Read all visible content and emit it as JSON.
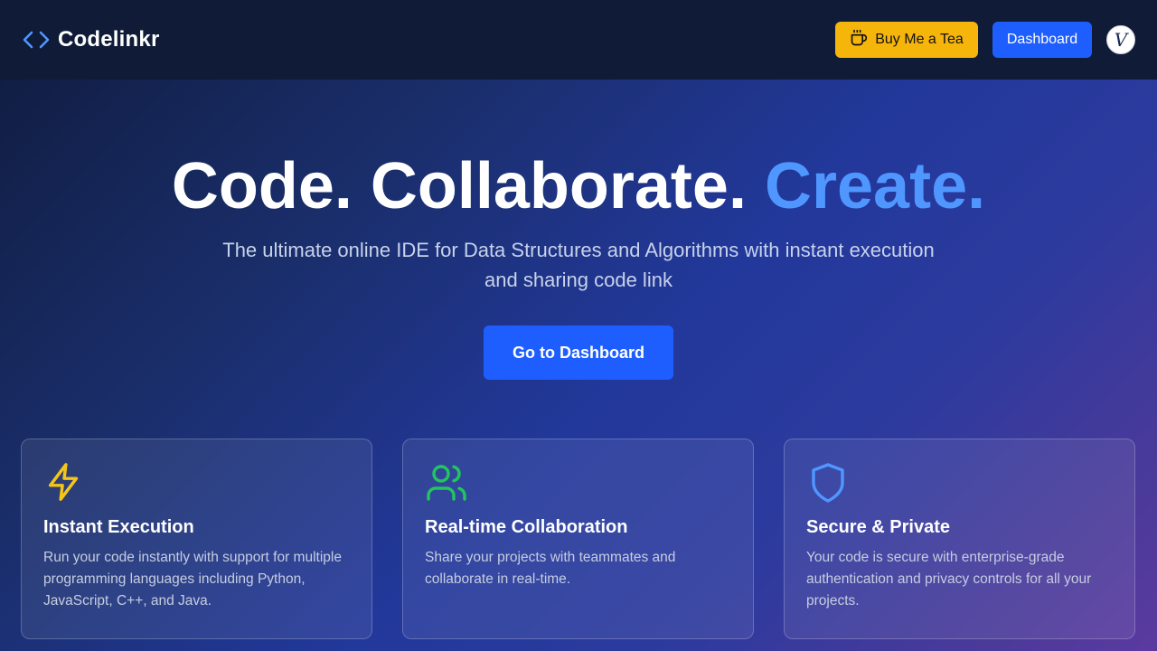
{
  "header": {
    "brand_name": "Codelinkr",
    "brand_icon": "code-brackets-icon",
    "tea_button_label": "Buy Me a Tea",
    "tea_icon": "cup-icon",
    "dashboard_button_label": "Dashboard",
    "avatar_letter": "V"
  },
  "hero": {
    "title_part1": "Code. Collaborate.",
    "title_accent": "Create.",
    "subtitle": "The ultimate online IDE for Data Structures and Algorithms with instant execution and sharing code link",
    "cta_label": "Go to Dashboard"
  },
  "features": [
    {
      "icon": "lightning-icon",
      "icon_color": "#f5c518",
      "title": "Instant Execution",
      "text": "Run your code instantly with support for multiple programming languages including Python, JavaScript, C++, and Java."
    },
    {
      "icon": "users-icon",
      "icon_color": "#22c55e",
      "title": "Real-time Collaboration",
      "text": "Share your projects with teammates and collaborate in real-time."
    },
    {
      "icon": "shield-icon",
      "icon_color": "#4f97ff",
      "title": "Secure & Private",
      "text": "Your code is secure with enterprise-grade authentication and privacy controls for all your projects."
    }
  ],
  "colors": {
    "accent": "#4f97ff",
    "primary_button": "#1e5eff",
    "tea_button": "#f5b50a",
    "navbar": "#101b37"
  }
}
